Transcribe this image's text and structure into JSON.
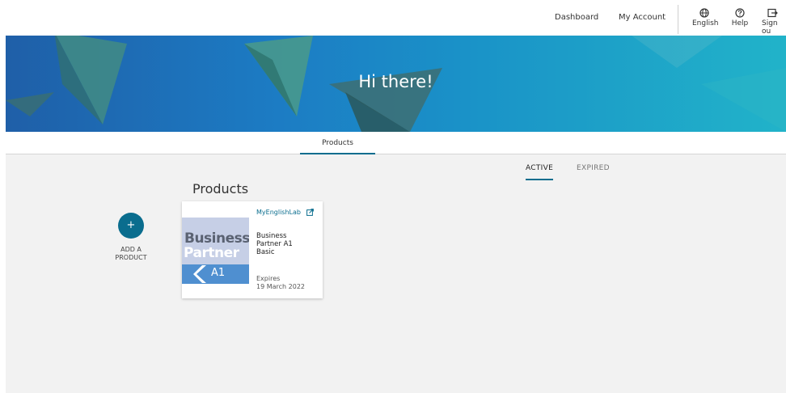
{
  "topnav": {
    "dashboard": "Dashboard",
    "my_account": "My Account",
    "language": "English",
    "help": "Help",
    "sign_out": "Sign ou"
  },
  "hero": {
    "greeting": "Hi there!"
  },
  "tabs": {
    "products": "Products"
  },
  "filters": {
    "active": "ACTIVE",
    "expired": "EXPIRED"
  },
  "section": {
    "title": "Products"
  },
  "add_product": {
    "icon": "+",
    "line1": "ADD A",
    "line2": "PRODUCT"
  },
  "product_card": {
    "thumbnail": {
      "word1": "Business",
      "word2": "Partner",
      "level": "A1"
    },
    "brand": "MyEnglishLab",
    "name": "Business Partner A1 Basic",
    "expires_label": "Expires",
    "expires_date": "19 March 2022"
  },
  "colors": {
    "accent": "#0a6d8e",
    "background": "#f2f2f2"
  }
}
